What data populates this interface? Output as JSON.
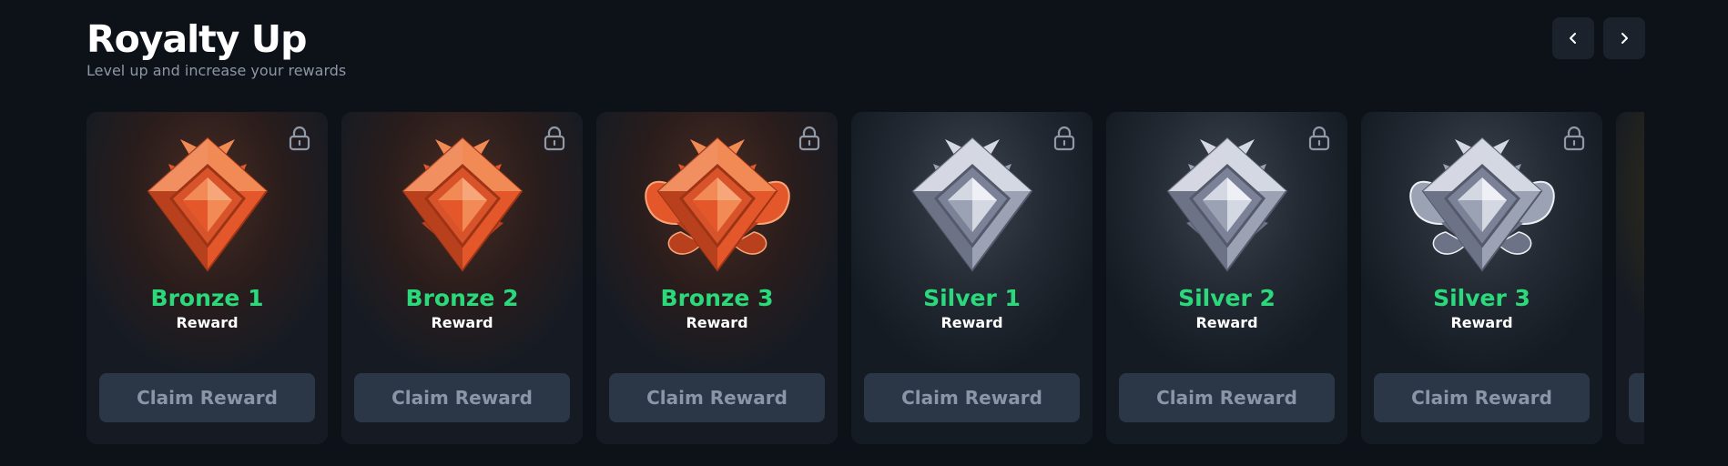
{
  "header": {
    "title": "Royalty Up",
    "subtitle": "Level up and increase your rewards"
  },
  "nav": {
    "prev_icon": "chevron-left-icon",
    "next_icon": "chevron-right-icon"
  },
  "colors": {
    "background": "#0d1219",
    "accent_green": "#2bd97b",
    "button_bg": "#2b3646",
    "button_text": "#8a96a8"
  },
  "cards": [
    {
      "tier": "bronze",
      "name": "Bronze 1",
      "sub": "Reward",
      "button": "Claim Reward",
      "icon": "bronze-1-badge-icon",
      "locked": true
    },
    {
      "tier": "bronze",
      "name": "Bronze 2",
      "sub": "Reward",
      "button": "Claim Reward",
      "icon": "bronze-2-badge-icon",
      "locked": true
    },
    {
      "tier": "bronze",
      "name": "Bronze 3",
      "sub": "Reward",
      "button": "Claim Reward",
      "icon": "bronze-3-badge-icon",
      "locked": true
    },
    {
      "tier": "silver",
      "name": "Silver 1",
      "sub": "Reward",
      "button": "Claim Reward",
      "icon": "silver-1-badge-icon",
      "locked": true
    },
    {
      "tier": "silver",
      "name": "Silver 2",
      "sub": "Reward",
      "button": "Claim Reward",
      "icon": "silver-2-badge-icon",
      "locked": true
    },
    {
      "tier": "silver",
      "name": "Silver 3",
      "sub": "Reward",
      "button": "Claim Reward",
      "icon": "silver-3-badge-icon",
      "locked": true
    },
    {
      "tier": "gold",
      "name": "",
      "sub": "",
      "button": "",
      "icon": "",
      "locked": false,
      "partial": true
    }
  ]
}
